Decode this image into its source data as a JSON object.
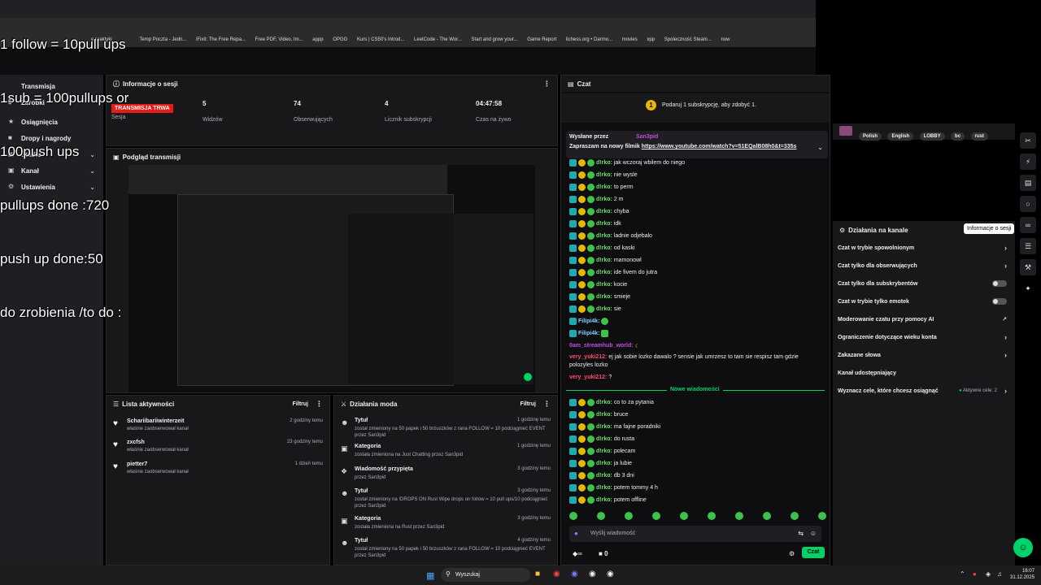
{
  "overlay": {
    "lines": [
      "1 follow = 10pull ups",
      "1sub = 100pullups or",
      "100push ups",
      "pullups done :720",
      "push up done:50",
      "do zrobienia /to do :"
    ]
  },
  "bookmarks": [
    "e praktyki",
    "Temp Poczta - Jedn...",
    "iFixit: The Free Repa...",
    "Free PDF, Video, Im...",
    "appp",
    "OPGG",
    "Kurs | CS50's Introd...",
    "LeetCode - The Wor...",
    "Start and grow your...",
    "Game Report",
    "lichess.org • Darmo...",
    "movies",
    "xpp",
    "Spoleczność Steam...",
    "now"
  ],
  "nav": {
    "items": [
      {
        "label": "Transmisja"
      },
      {
        "label": "Zarobki"
      },
      {
        "label": "Osiągnięcia"
      },
      {
        "label": "Dropy i nagrody"
      },
      {
        "label": "Studio"
      },
      {
        "label": "Kanał"
      },
      {
        "label": "Ustawienia"
      }
    ]
  },
  "session": {
    "title": "Informacje o sesji",
    "live_badge": "TRANSMISJA TRWA",
    "sesja_label": "Sesja",
    "stats": [
      {
        "value": "5",
        "label": "Widzów"
      },
      {
        "value": "74",
        "label": "Obserwujących"
      },
      {
        "value": "4",
        "label": "Licznik subskrypcji"
      },
      {
        "value": "04:47:58",
        "label": "Czas na żywo"
      }
    ]
  },
  "preview": {
    "title": "Podgląd transmisji"
  },
  "activity": {
    "title": "Lista aktywności",
    "filter": "Filtruj",
    "items": [
      {
        "name": "Schariibariiwinterzeit",
        "sub": "właśnie zaobserwował kanał",
        "time": "2 godziny temu"
      },
      {
        "name": "zxcfsh",
        "sub": "właśnie zaobserwował kanał",
        "time": "23 godziny temu"
      },
      {
        "name": "pietter7",
        "sub": "właśnie zaobserwował kanał",
        "time": "1 dzień temu"
      }
    ]
  },
  "mod": {
    "title": "Działania moda",
    "filter": "Filtruj",
    "items": [
      {
        "name": "Tytuł",
        "sub": "został zmieniony na 50 papek i 50 brzuszków z rana FOLLOW = 10 podciągnieć EVENT przez San3pid",
        "time": "1 godzinę temu"
      },
      {
        "name": "Kategoria",
        "sub": "została zmieniona na Just Chatting przez San3pid",
        "time": "1 godzinę temu"
      },
      {
        "name": "Wiadomość przypięta",
        "sub": "przez San3pid",
        "time": "3 godziny temu"
      },
      {
        "name": "Tytuł",
        "sub": "został zmieniony na !DROPS ON Rust Wipe drops on follow = 10 pull ups/10 podciągnieć przez San3pid",
        "time": "3 godziny temu"
      },
      {
        "name": "Kategoria",
        "sub": "została zmieniona na Rust przez San3pid",
        "time": "3 godziny temu"
      },
      {
        "name": "Tytuł",
        "sub": "został zmieniony na 50 papek i 50 brzuszków z rana FOLLOW = 10 podciągnieć EVENT przez San3pid",
        "time": "4 godziny temu"
      }
    ]
  },
  "chat": {
    "title": "Czat",
    "gift_text": "Podaruj 1 subskrypcję, aby zdobyć 1.",
    "pinned_label": "Wysłane przez",
    "pinned_user": "San3pid",
    "pinned_text": "Zapraszam na nowy filmik",
    "pinned_link": "https://www.youtube.com/watch?v=51EQalB08h0&t=335s",
    "messages": [
      {
        "user": "d!rko:",
        "text": "jak wczoraj wbilem do niego"
      },
      {
        "user": "d!rko:",
        "text": "nie wysle"
      },
      {
        "user": "d!rko:",
        "text": "to perm"
      },
      {
        "user": "d!rko:",
        "text": "2 m"
      },
      {
        "user": "d!rko:",
        "text": "chyba"
      },
      {
        "user": "d!rko:",
        "text": "idk"
      },
      {
        "user": "d!rko:",
        "text": "ladnie odjebalo"
      },
      {
        "user": "d!rko:",
        "text": "od kaski"
      },
      {
        "user": "d!rko:",
        "text": "mamonowl"
      },
      {
        "user": "d!rko:",
        "text": "ide fivem do jutra"
      },
      {
        "user": "d!rko:",
        "text": "kocie"
      },
      {
        "user": "d!rko:",
        "text": "smieje"
      },
      {
        "user": "d!rko:",
        "text": "sie"
      },
      {
        "user": "Filipi4k:",
        "text": ""
      },
      {
        "user": "Filipi4k:",
        "text": ""
      }
    ],
    "stream_msg_user": "0am_streamhub_world:",
    "yuki1_user": "very_yuki212:",
    "yuki1_text": "ej jak sobie lozko dawalo ? sensie jak umrzesz to tam sie respisz tam gdzie polozyles lozko",
    "yuki2_user": "very_yuki212:",
    "yuki2_text": "?",
    "new_messages": "Nowe wiadomości",
    "new": [
      {
        "user": "d!rko:",
        "text": "co to za pytania"
      },
      {
        "user": "d!rko:",
        "text": "bruce"
      },
      {
        "user": "d!rko:",
        "text": "ma fajne poradniki"
      },
      {
        "user": "d!rko:",
        "text": "do rusta"
      },
      {
        "user": "d!rko:",
        "text": "polecam"
      },
      {
        "user": "d!rko:",
        "text": "ja lubie"
      },
      {
        "user": "d!rko:",
        "text": "db 3 dni"
      },
      {
        "user": "d!rko:",
        "text": "potem tommy 4 h"
      },
      {
        "user": "d!rko:",
        "text": "potem offline"
      }
    ],
    "input_placeholder": "Wyślij wiadomość",
    "points": "0",
    "send": "Czat"
  },
  "tags": [
    "Polish",
    "English",
    "LOBBY",
    "bc",
    "rust"
  ],
  "actions": {
    "title": "Działania na kanale",
    "tooltip": "Informacje o sesji",
    "items": [
      {
        "label": "Czat w trybie spowolnionym"
      },
      {
        "label": "Czat tylko dla obserwujących"
      },
      {
        "label": "Czat tylko dla subskrybentów"
      },
      {
        "label": "Czat w trybie tylko emotek"
      },
      {
        "label": "Moderowanie czatu przy pomocy AI"
      },
      {
        "label": "Ograniczenie dotyczące wieku konta"
      },
      {
        "label": "Zakazane słowa"
      },
      {
        "label": "Kanał udostępniający"
      },
      {
        "label": "Wyznacz cele, które chcesz osiągnąć"
      }
    ],
    "goals_status": "Aktywne cele: 2"
  },
  "taskbar": {
    "search": "Wyszukaj",
    "time": "16:07",
    "date": "31.12.2025"
  }
}
